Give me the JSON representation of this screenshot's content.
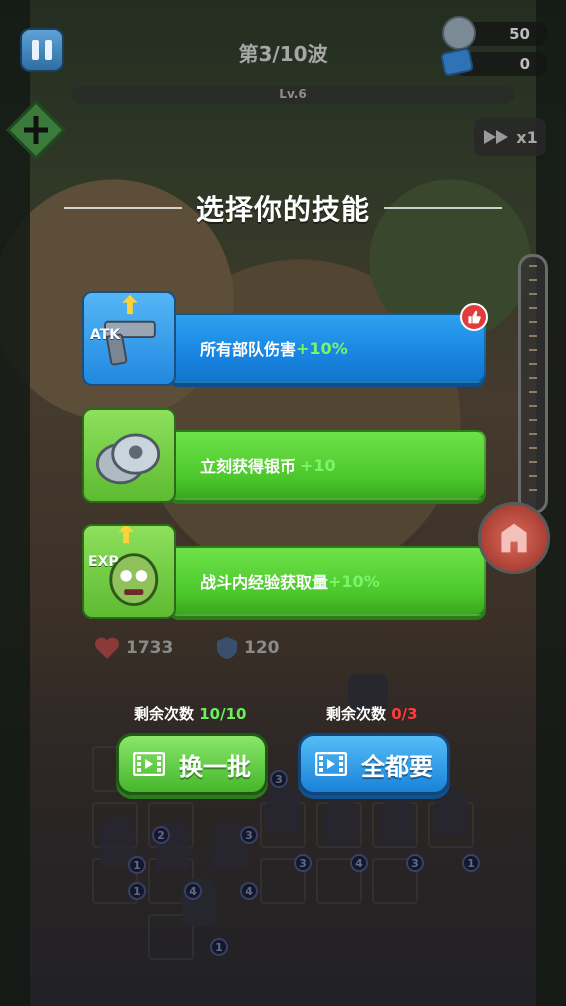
{
  "hud": {
    "wave": "第3/10波",
    "level": "Lv.6",
    "silver": "50",
    "tickets": "0",
    "speed": "x1"
  },
  "panel": {
    "title": "选择你的技能",
    "cards": [
      {
        "text": "所有部队伤害",
        "value": "+10%",
        "icon": "atk-pistol-icon",
        "icon_label": "ATK"
      },
      {
        "text": "立刻获得银币",
        "value": "+10",
        "icon": "silver-coins-icon"
      },
      {
        "text": "战斗内经验获取量",
        "value": "+10%",
        "icon": "exp-zombie-head-icon",
        "icon_label": "EXP"
      }
    ]
  },
  "stats": {
    "hp": "1733",
    "defense": "120"
  },
  "actions": {
    "refresh": {
      "remain_label": "剩余次数",
      "remain_value": "10/10",
      "label": "换一批"
    },
    "take_all": {
      "remain_label": "剩余次数",
      "remain_value": "0/3",
      "label": "全都要"
    }
  },
  "units": {
    "badges": [
      "3",
      "3",
      "1",
      "2",
      "3",
      "4",
      "3",
      "1",
      "1",
      "4",
      "4",
      "1"
    ]
  },
  "colors": {
    "blue_card": "#1985e2",
    "green_card": "#4bc72b",
    "bonus_green": "#79f56a",
    "remain_red": "#ff3b3b"
  }
}
